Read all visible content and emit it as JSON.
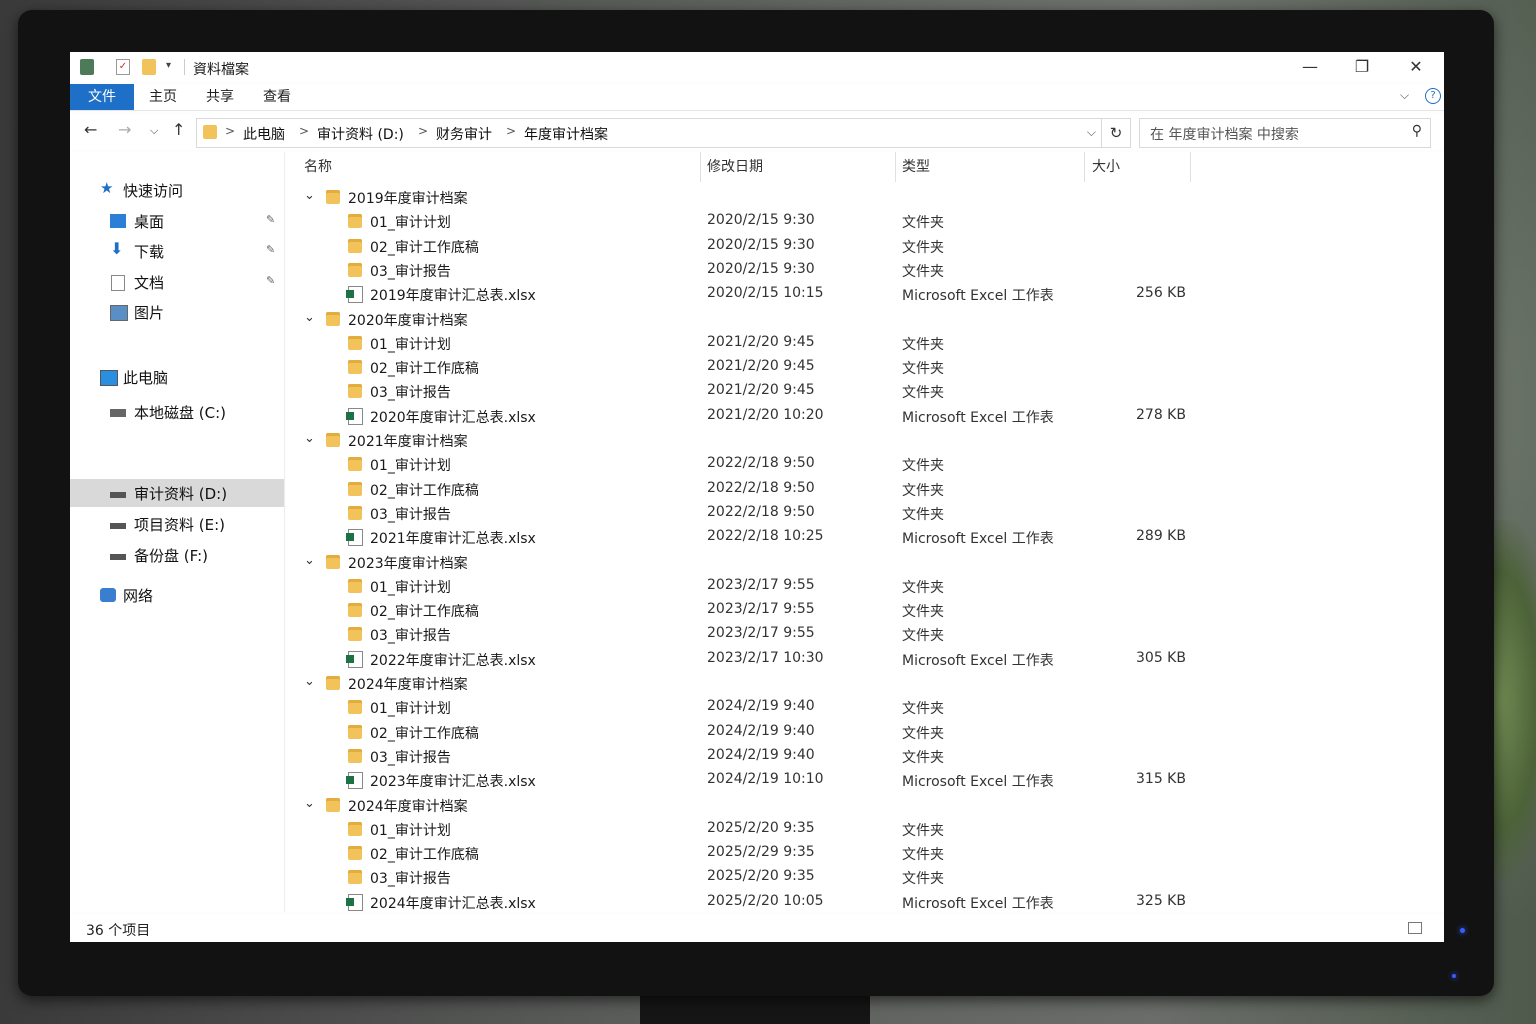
{
  "window": {
    "title": "資料檔案",
    "qa_check": "✓",
    "qa_arrow": "▾",
    "min": "—",
    "max": "❐",
    "close": "✕"
  },
  "ribbon": {
    "tabs": [
      "文件",
      "主页",
      "共享",
      "查看"
    ],
    "chevron": "⌵",
    "help": "?"
  },
  "nav": {
    "back": "←",
    "forward": "→",
    "recent": "⌵",
    "up": "↑",
    "breadcrumb": [
      "此电脑",
      "审计资料 (D:)",
      "财务审计",
      "年度审计档案"
    ],
    "sep": ">",
    "dropdown": "⌵",
    "refresh": "↻",
    "search_placeholder": "在 年度审计档案 中搜索",
    "search_icon": "⚲"
  },
  "sidebar": {
    "pin": "✎",
    "items": [
      {
        "label": "快速访问",
        "icon": "star-icon"
      },
      {
        "label": "桌面",
        "icon": "desktop-icon",
        "pinned": true
      },
      {
        "label": "下载",
        "icon": "download-icon",
        "pinned": true
      },
      {
        "label": "文档",
        "icon": "document-icon",
        "pinned": true
      },
      {
        "label": "图片",
        "icon": "picture-icon"
      },
      {
        "label": "此电脑",
        "icon": "computer-icon"
      },
      {
        "label": "本地磁盘 (C:)",
        "icon": "drive-icon"
      },
      {
        "label": "审计资料 (D:)",
        "icon": "drive-icon",
        "selected": true
      },
      {
        "label": "项目资料 (E:)",
        "icon": "drive-icon"
      },
      {
        "label": "备份盘 (F:)",
        "icon": "drive-icon"
      },
      {
        "label": "网络",
        "icon": "network-icon"
      }
    ]
  },
  "columns": {
    "name": "名称",
    "date": "修改日期",
    "type": "类型",
    "size": "大小"
  },
  "rows": [
    {
      "kind": "group",
      "chev": "⌄",
      "name": "2019年度审计档案"
    },
    {
      "kind": "folder",
      "name": "01_审计计划",
      "date": "2020/2/15  9:30",
      "type": "文件夹",
      "size": ""
    },
    {
      "kind": "folder",
      "name": "02_审计工作底稿",
      "date": "2020/2/15  9:30",
      "type": "文件夹",
      "size": ""
    },
    {
      "kind": "folder",
      "name": "03_审计报告",
      "date": "2020/2/15  9:30",
      "type": "文件夹",
      "size": ""
    },
    {
      "kind": "xls",
      "name": "2019年度审计汇总表.xlsx",
      "date": "2020/2/15  10:15",
      "type": "Microsoft Excel 工作表",
      "size": "256 KB"
    },
    {
      "kind": "group",
      "chev": "⌄",
      "name": "2020年度审计档案"
    },
    {
      "kind": "folder",
      "name": "01_审计计划",
      "date": "2021/2/20  9:45",
      "type": "文件夹",
      "size": ""
    },
    {
      "kind": "folder",
      "name": "02_审计工作底稿",
      "date": "2021/2/20  9:45",
      "type": "文件夹",
      "size": ""
    },
    {
      "kind": "folder",
      "name": "03_审计报告",
      "date": "2021/2/20  9:45",
      "type": "文件夹",
      "size": ""
    },
    {
      "kind": "xls",
      "name": "2020年度审计汇总表.xlsx",
      "date": "2021/2/20  10:20",
      "type": "Microsoft Excel 工作表",
      "size": "278 KB"
    },
    {
      "kind": "group",
      "chev": "⌄",
      "name": "2021年度审计档案"
    },
    {
      "kind": "folder",
      "name": "01_审计计划",
      "date": "2022/2/18  9:50",
      "type": "文件夹",
      "size": ""
    },
    {
      "kind": "folder",
      "name": "02_审计工作底稿",
      "date": "2022/2/18  9:50",
      "type": "文件夹",
      "size": ""
    },
    {
      "kind": "folder",
      "name": "03_审计报告",
      "date": "2022/2/18  9:50",
      "type": "文件夹",
      "size": ""
    },
    {
      "kind": "xls",
      "name": "2021年度审计汇总表.xlsx",
      "date": "2022/2/18  10:25",
      "type": "Microsoft Excel 工作表",
      "size": "289 KB"
    },
    {
      "kind": "group",
      "chev": "⌄",
      "name": "2023年度审计档案"
    },
    {
      "kind": "folder",
      "name": "01_审计计划",
      "date": "2023/2/17  9:55",
      "type": "文件夹",
      "size": ""
    },
    {
      "kind": "folder",
      "name": "02_审计工作底稿",
      "date": "2023/2/17  9:55",
      "type": "文件夹",
      "size": ""
    },
    {
      "kind": "folder",
      "name": "03_审计报告",
      "date": "2023/2/17  9:55",
      "type": "文件夹",
      "size": ""
    },
    {
      "kind": "xls",
      "name": "2022年度审计汇总表.xlsx",
      "date": "2023/2/17  10:30",
      "type": "Microsoft Excel 工作表",
      "size": "305 KB"
    },
    {
      "kind": "group",
      "chev": "⌄",
      "name": "2024年度审计档案"
    },
    {
      "kind": "folder",
      "name": "01_审计计划",
      "date": "2024/2/19  9:40",
      "type": "文件夹",
      "size": ""
    },
    {
      "kind": "folder",
      "name": "02_审计工作底稿",
      "date": "2024/2/19  9:40",
      "type": "文件夹",
      "size": ""
    },
    {
      "kind": "folder",
      "name": "03_审计报告",
      "date": "2024/2/19  9:40",
      "type": "文件夹",
      "size": ""
    },
    {
      "kind": "xls",
      "name": "2023年度审计汇总表.xlsx",
      "date": "2024/2/19  10:10",
      "type": "Microsoft Excel 工作表",
      "size": "315 KB"
    },
    {
      "kind": "group",
      "chev": "⌄",
      "name": "2024年度审计档案"
    },
    {
      "kind": "folder",
      "name": "01_审计计划",
      "date": "2025/2/20  9:35",
      "type": "文件夹",
      "size": ""
    },
    {
      "kind": "folder",
      "name": "02_审计工作底稿",
      "date": "2025/2/29  9:35",
      "type": "文件夹",
      "size": ""
    },
    {
      "kind": "folder",
      "name": "03_审计报告",
      "date": "2025/2/20  9:35",
      "type": "文件夹",
      "size": ""
    },
    {
      "kind": "xls",
      "name": "2024年度审计汇总表.xlsx",
      "date": "2025/2/20  10:05",
      "type": "Microsoft Excel 工作表",
      "size": "325 KB"
    }
  ],
  "status": {
    "count": "36 个项目"
  }
}
